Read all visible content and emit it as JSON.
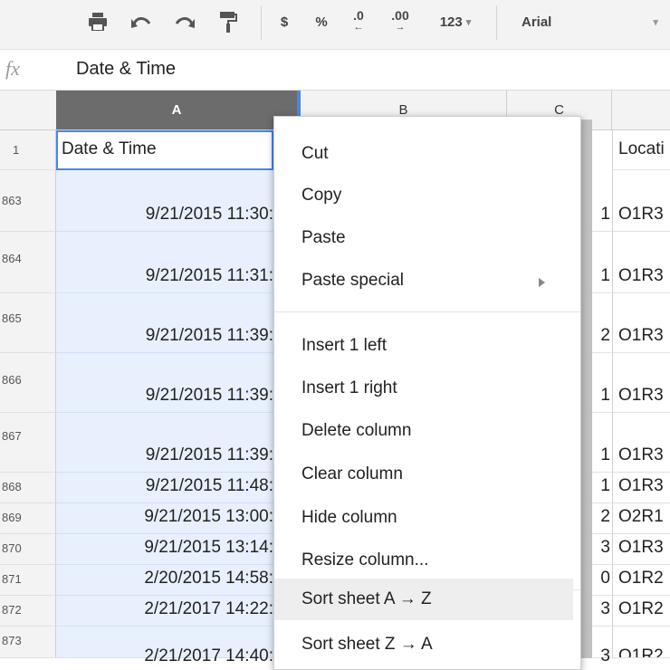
{
  "toolbar": {
    "currency": "$",
    "percent": "%",
    "dec_decrease": ".0",
    "dec_increase": ".00",
    "number_format": "123",
    "font": "Arial"
  },
  "formula_bar": {
    "value": "Date & Time"
  },
  "column_headers": [
    "A",
    "B",
    "C"
  ],
  "header_row": {
    "row_number": "1",
    "col_a": "Date & Time",
    "col_d": "Locati"
  },
  "rows": [
    {
      "n": "863",
      "a": "9/21/2015 11:30:",
      "c": "1",
      "d": "O1R3"
    },
    {
      "n": "864",
      "a": "9/21/2015 11:31:",
      "c": "1",
      "d": "O1R3"
    },
    {
      "n": "865",
      "a": "9/21/2015 11:39:",
      "c": "2",
      "d": "O1R3"
    },
    {
      "n": "866",
      "a": "9/21/2015 11:39:",
      "c": "1",
      "d": "O1R3"
    },
    {
      "n": "867",
      "a": "9/21/2015 11:39:",
      "c": "1",
      "d": "O1R3"
    },
    {
      "n": "868",
      "a": "9/21/2015 11:48:",
      "c": "1",
      "d": "O1R3"
    },
    {
      "n": "869",
      "a": "9/21/2015 13:00:",
      "c": "2",
      "d": "O2R1"
    },
    {
      "n": "870",
      "a": "9/21/2015 13:14:",
      "c": "3",
      "d": "O1R3"
    },
    {
      "n": "871",
      "a": "2/20/2015 14:58:",
      "c": "0",
      "d": "O1R2"
    },
    {
      "n": "872",
      "a": "2/21/2017 14:22:",
      "c": "3",
      "d": "O1R2"
    },
    {
      "n": "873",
      "a": "2/21/2017 14:40:",
      "c": "3",
      "d": "O1R2"
    }
  ],
  "context_menu": {
    "items": [
      "Cut",
      "Copy",
      "Paste",
      "Paste special",
      "Insert 1 left",
      "Insert 1 right",
      "Delete column",
      "Clear column",
      "Hide column",
      "Resize column...",
      "Sort sheet A → Z",
      "Sort sheet Z → A"
    ]
  },
  "colors": {
    "selection": "#e8f0fe",
    "selected_header": "#6c6c6c",
    "accent": "#4a86e8"
  }
}
